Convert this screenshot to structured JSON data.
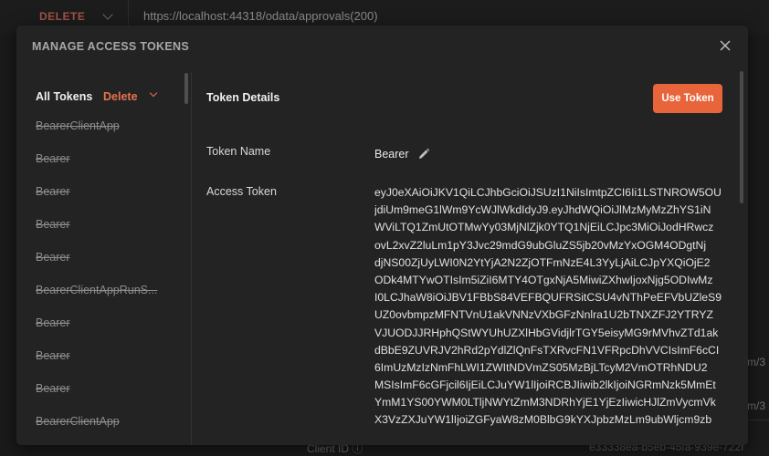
{
  "background": {
    "method": "DELETE",
    "url": "https://localhost:44318/odata/approvals(200)",
    "fragment_1": "m/3",
    "fragment_2": "m/3",
    "client_id_label": "Client ID ⓘ",
    "client_id_value": "e33338ea-b5eb-45fa-939e-722f"
  },
  "modal": {
    "title": "MANAGE ACCESS TOKENS",
    "close_icon": "close-icon"
  },
  "sidebar": {
    "all_tokens_label": "All Tokens",
    "delete_label": "Delete",
    "tokens": [
      "BearerClientApp",
      "Bearer",
      "Bearer",
      "Bearer",
      "Bearer",
      "BearerClientAppRunS...",
      "Bearer",
      "Bearer",
      "Bearer",
      "BearerClientApp"
    ]
  },
  "details": {
    "title": "Token Details",
    "use_token_label": "Use Token",
    "token_name_label": "Token Name",
    "token_name_value": "Bearer",
    "edit_icon": "pencil-icon",
    "access_token_label": "Access Token",
    "access_token_lines": [
      "eyJ0eXAiOiJKV1QiLCJhbGciOiJSUzI1NiIsImtpZCI6Ii1LSTNROW5OU",
      "jdiUm9meG1lWm9YcWJlWkdIdyJ9.eyJhdWQiOiJlMzMyMzZhYS1iN",
      "WViLTQ1ZmUtOTMwYy03MjNlZjk0YTQ1NjEiLCJpc3MiOiJodHRwcz",
      "ovL2xvZ2luLm1pY3Jvc29mdG9ubGluZS5jb20vMzYxOGM4ODgtNj",
      "djNS00ZjUyLWI0N2YtYjA2N2ZjOTFmNzE4L3YyLjAiLCJpYXQiOjE2",
      "ODk4MTYwOTIsIm5iZiI6MTY4OTgxNjA5MiwiZXhwIjoxNjg5ODIwMz",
      "I0LCJhaW8iOiJBV1FBbS84VEFBQUFRSitCSU4vNThPeEFVbUZleS9",
      "UZ0ovbmpzMFNTVnU1akVNNzVXbGFzNnlra1U2bTNXZFJ2YTRYZ",
      "VJUODJJRHphQStWYUhUZXlHbGVidjlrTGY5eisyMG9rMVhvZTd1ak",
      "dBbE9ZUVRJV2hRd2pYdlZlQnFsTXRvcFN1VFRpcDhVVCIsImF6cCI",
      "6ImUzMzIzNmFhLWI1ZWItNDVmZS05MzBjLTcyM2VmOTRhNDU2",
      "MSIsImF6cGFjcil6IjEiLCJuYW1lIjoiRCBJIiwib2lkIjoiNGRmNzk5MmEt",
      "YmM1YS00YWM0LTljNWYtZmM3NDRhYjE1YjEzIiwicHJlZmVycmVk",
      "X3VzZXJuYW1lIjoiZGFyaW8zM0BlbG9kYXJpbzMzLm9ubWljcm9zb"
    ]
  }
}
